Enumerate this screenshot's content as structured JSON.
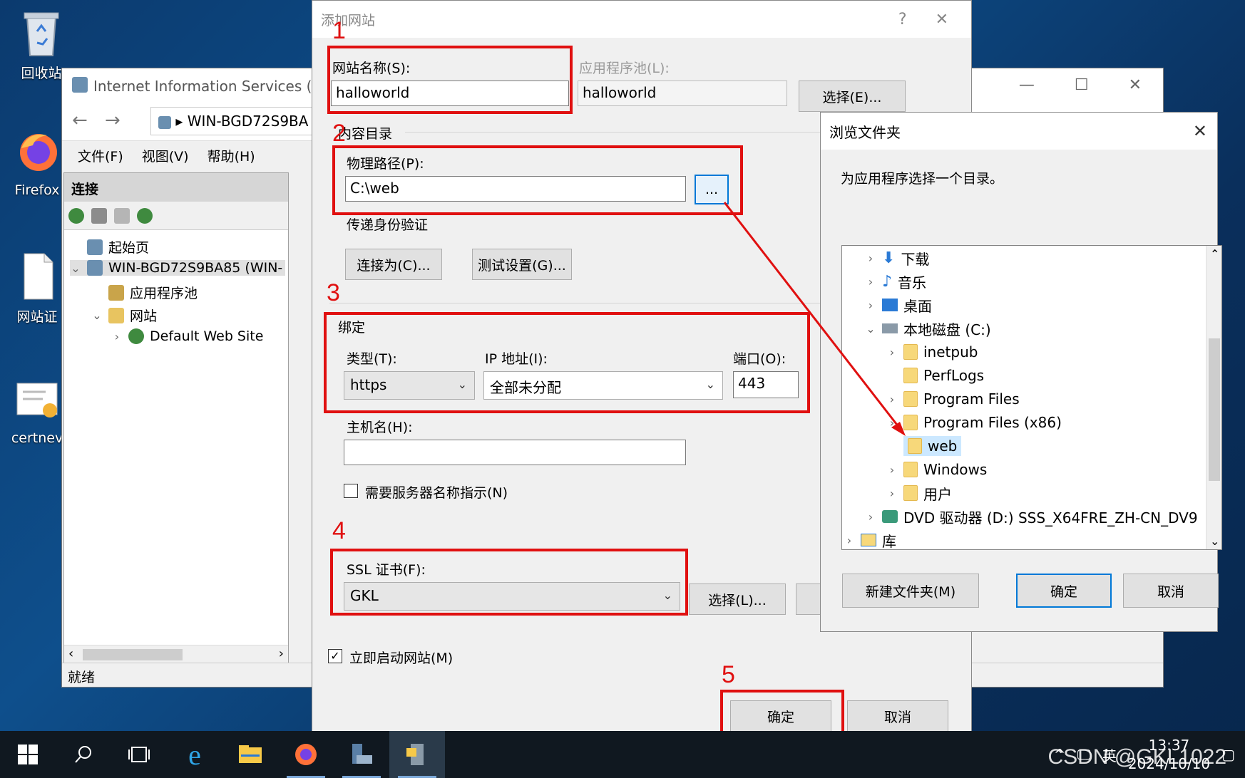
{
  "desktop": {
    "icons": [
      {
        "label": "回收站",
        "icon": "recycle-bin-icon"
      },
      {
        "label": "Firefox",
        "icon": "firefox-icon"
      },
      {
        "label": "网站证",
        "icon": "document-icon"
      },
      {
        "label": "certnev",
        "icon": "certificate-icon"
      }
    ]
  },
  "iis": {
    "title": "Internet Information Services (IIS)管",
    "address": "WIN-BGD72S9BA",
    "menu": [
      "文件(F)",
      "视图(V)",
      "帮助(H)"
    ],
    "connections_header": "连接",
    "tree": {
      "start_page": "起始页",
      "server": "WIN-BGD72S9BA85 (WIN-",
      "app_pools": "应用程序池",
      "sites": "网站",
      "default_site": "Default Web Site"
    },
    "status": "就绪"
  },
  "add_site": {
    "title": "添加网站",
    "help": "?",
    "close": "✕",
    "site_name_label": "网站名称(S):",
    "site_name_value": "halloworld",
    "app_pool_label": "应用程序池(L):",
    "app_pool_value": "halloworld",
    "select_pool_button": "选择(E)...",
    "content_dir_label": "内容目录",
    "physical_path_label": "物理路径(P):",
    "physical_path_value": "C:\\web",
    "browse_button": "...",
    "pass_auth_label": "传递身份验证",
    "connect_as_button": "连接为(C)...",
    "test_settings_button": "测试设置(G)...",
    "binding_label": "绑定",
    "type_label": "类型(T):",
    "type_value": "https",
    "ip_label": "IP 地址(I):",
    "ip_value": "全部未分配",
    "port_label": "端口(O):",
    "port_value": "443",
    "hostname_label": "主机名(H):",
    "hostname_value": "",
    "sni_label": "需要服务器名称指示(N)",
    "ssl_label": "SSL 证书(F):",
    "ssl_value": "GKL",
    "ssl_select_button": "选择(L)...",
    "start_immediately_label": "立即启动网站(M)",
    "ok_button": "确定",
    "cancel_button": "取消"
  },
  "annotations": [
    "1",
    "2",
    "3",
    "4",
    "5"
  ],
  "browse": {
    "title": "浏览文件夹",
    "description": "为应用程序选择一个目录。",
    "items": [
      {
        "label": "下载",
        "icon": "download-icon"
      },
      {
        "label": "音乐",
        "icon": "music-icon"
      },
      {
        "label": "桌面",
        "icon": "desktop-icon"
      },
      {
        "label": "本地磁盘 (C:)",
        "icon": "drive-icon"
      },
      {
        "label": "inetpub",
        "icon": "folder-icon"
      },
      {
        "label": "PerfLogs",
        "icon": "folder-icon"
      },
      {
        "label": "Program Files",
        "icon": "folder-icon"
      },
      {
        "label": "Program Files (x86)",
        "icon": "folder-icon"
      },
      {
        "label": "web",
        "icon": "folder-icon"
      },
      {
        "label": "Windows",
        "icon": "folder-icon"
      },
      {
        "label": "用户",
        "icon": "folder-icon"
      },
      {
        "label": "DVD 驱动器 (D:) SSS_X64FRE_ZH-CN_DV9",
        "icon": "dvd-icon"
      },
      {
        "label": "库",
        "icon": "library-icon"
      }
    ],
    "new_folder_button": "新建文件夹(M)",
    "ok_button": "确定",
    "cancel_button": "取消"
  },
  "taskbar": {
    "time": "13:37",
    "date": "2024/10/10",
    "ime": "英",
    "watermark": "CSDN @GKL1022"
  },
  "colors": {
    "annotation_red": "#e01010",
    "accent_blue": "#0078d7",
    "selection": "#cce8ff"
  }
}
